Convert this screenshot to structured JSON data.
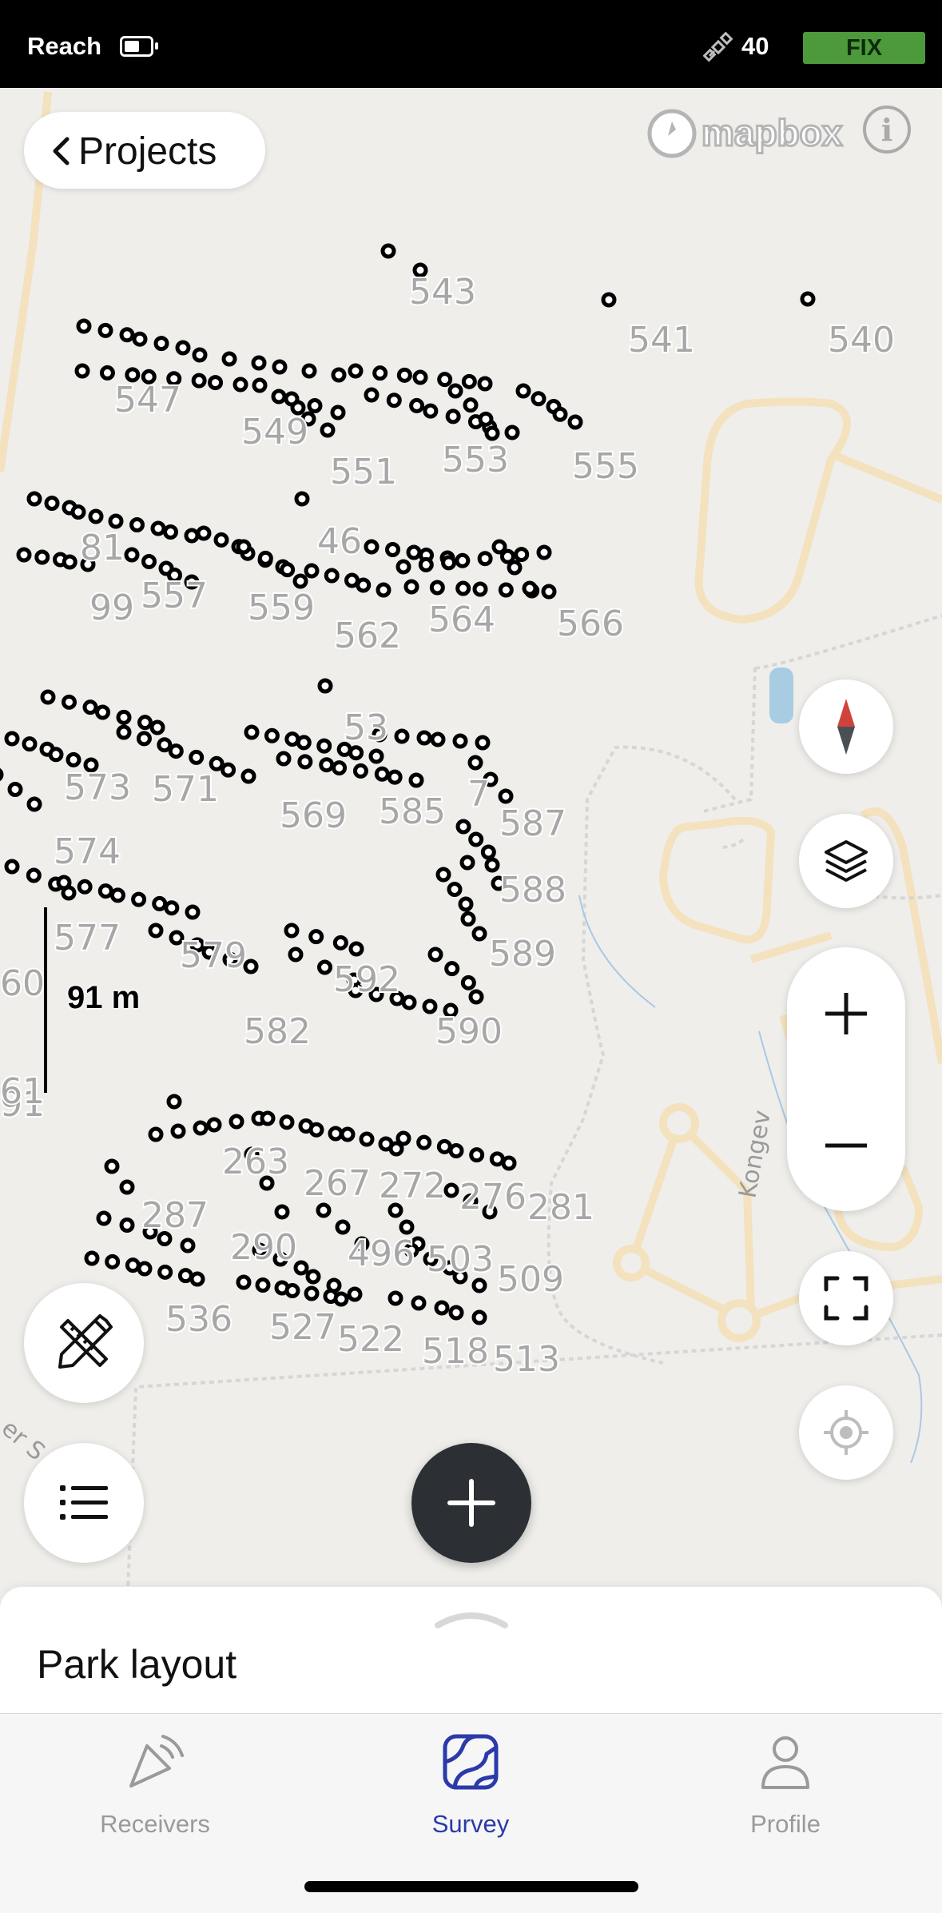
{
  "status_bar": {
    "carrier": "Reach",
    "battery_level": 0.6,
    "satellite_count": "40",
    "fix_status": "FIX",
    "fix_color": "#4c9a3c"
  },
  "header": {
    "back_label": "Projects",
    "map_attribution": "mapbox",
    "info_icon": "info-icon"
  },
  "map": {
    "point_labels": [
      "543",
      "541",
      "540",
      "547",
      "549",
      "551",
      "553",
      "555",
      "81",
      "46",
      "99",
      "557",
      "559",
      "562",
      "564",
      "566",
      "53",
      "573",
      "571",
      "569",
      "585",
      "587",
      "574",
      "588",
      "577",
      "579",
      "589",
      "592",
      "582",
      "590",
      "91",
      "263",
      "267",
      "272",
      "276",
      "281",
      "287",
      "290",
      "496",
      "503",
      "509",
      "536",
      "527",
      "522",
      "518",
      "513",
      "60",
      "61",
      "7"
    ],
    "scale_label": "91 m",
    "road_label": "Kongev"
  },
  "controls": {
    "compass_icon": "compass-icon",
    "layers_icon": "layers-icon",
    "zoom_in_icon": "plus-icon",
    "zoom_out_icon": "minus-icon",
    "fullscreen_icon": "fullscreen-icon",
    "locate_icon": "crosshair-icon",
    "tools_icon": "ruler-pencil-icon",
    "list_icon": "list-icon",
    "add_icon": "plus-icon"
  },
  "sheet": {
    "title": "Park layout"
  },
  "tabs": [
    {
      "label": "Receivers",
      "icon": "antenna-icon",
      "active": false
    },
    {
      "label": "Survey",
      "icon": "map-survey-icon",
      "active": true
    },
    {
      "label": "Profile",
      "icon": "person-icon",
      "active": false
    }
  ],
  "colors": {
    "accent": "#2b3aa8",
    "fab_dark": "#2c2f33",
    "compass_red": "#d0433a"
  }
}
